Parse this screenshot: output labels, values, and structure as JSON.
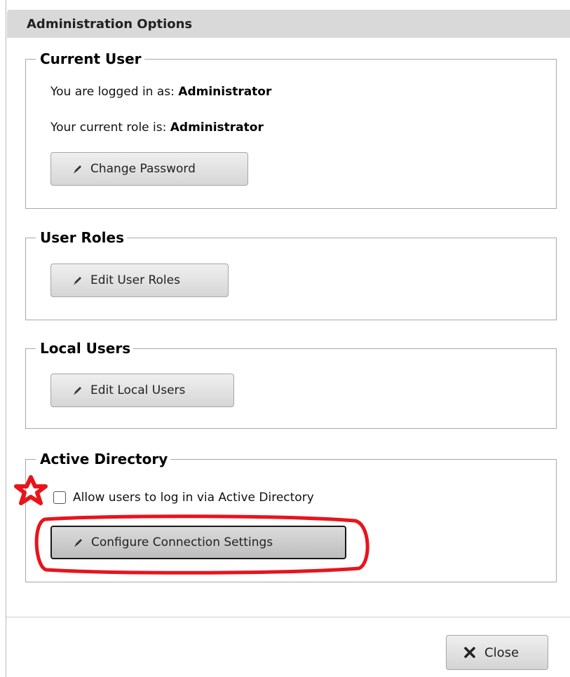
{
  "dialog": {
    "title": "Administration Options"
  },
  "current_user": {
    "legend": "Current User",
    "logged_in_prefix": "You are logged in as:",
    "logged_in_value": "Administrator",
    "role_prefix": "Your current role is:",
    "role_value": "Administrator",
    "change_password_label": "Change Password",
    "change_password_icon": "pencil-icon"
  },
  "user_roles": {
    "legend": "User Roles",
    "edit_label": "Edit User Roles",
    "edit_icon": "pencil-icon"
  },
  "local_users": {
    "legend": "Local Users",
    "edit_label": "Edit Local Users",
    "edit_icon": "pencil-icon"
  },
  "active_directory": {
    "legend": "Active Directory",
    "allow_checkbox_label": "Allow users to log in via Active Directory",
    "allow_checkbox_checked": false,
    "configure_label": "Configure Connection Settings",
    "configure_icon": "pencil-icon"
  },
  "annotations": {
    "star_color": "#e8141c",
    "highlight_color": "#e8141c"
  },
  "footer": {
    "close_label": "Close",
    "close_icon": "close-x-icon"
  }
}
